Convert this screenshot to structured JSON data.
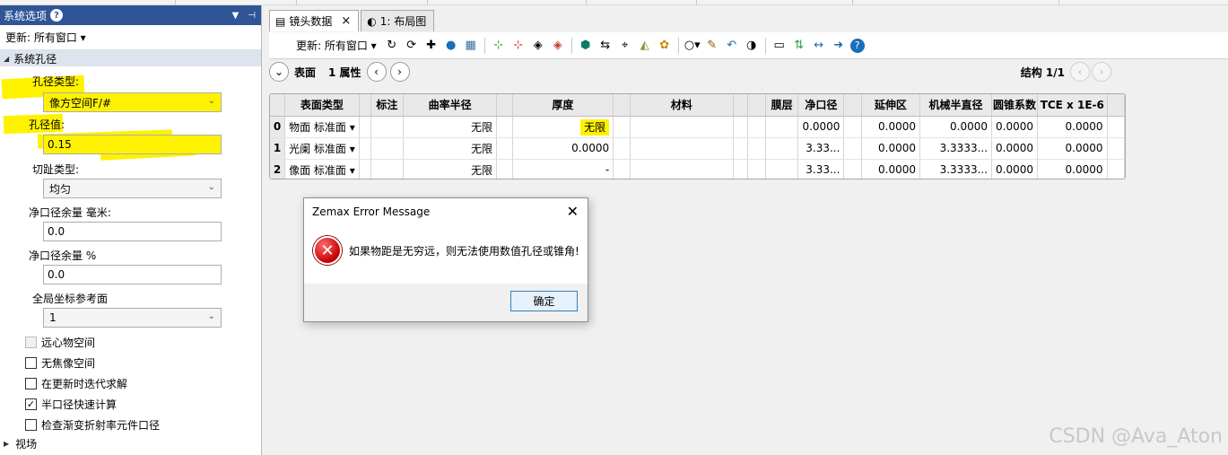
{
  "left_panel": {
    "title": "系统选项",
    "update_label": "更新: 所有窗口 ▾",
    "section": "系统孔径",
    "aperture_type_label": "孔径类型:",
    "aperture_type_value": "像方空间F/#",
    "aperture_value_label": "孔径值:",
    "aperture_value": "0.15",
    "apodization_label": "切趾类型:",
    "apodization_value": "均匀",
    "clear_margin_mm_label": "净口径余量 毫米:",
    "clear_margin_mm_value": "0.0",
    "clear_margin_pct_label": "净口径余量 %",
    "clear_margin_pct_value": "0.0",
    "global_ref_label": "全局坐标参考面",
    "global_ref_value": "1",
    "checkboxes": [
      {
        "label": "远心物空间",
        "checked": false,
        "disabled": true
      },
      {
        "label": "无焦像空间",
        "checked": false,
        "disabled": false
      },
      {
        "label": "在更新时迭代求解",
        "checked": false,
        "disabled": false
      },
      {
        "label": "半口径快速计算",
        "checked": true,
        "disabled": false
      },
      {
        "label": "检查渐变折射率元件口径",
        "checked": false,
        "disabled": false
      }
    ],
    "tree_field": "视场"
  },
  "tabs": [
    {
      "label": "镜头数据",
      "close": "×"
    },
    {
      "label": "1: 布局图"
    }
  ],
  "toolbar": {
    "update_label": "更新: 所有窗口 ▾"
  },
  "navbar": {
    "surface_label": "表面",
    "props_label": "1 属性",
    "config_label": "结构 1/1"
  },
  "table": {
    "headers": [
      "",
      "表面类型",
      "",
      "标注",
      "曲率半径",
      "",
      "厚度",
      "",
      "材料",
      "",
      "",
      "膜层",
      "净口径",
      "",
      "延伸区",
      "机械半直径",
      "圆锥系数",
      "TCE x 1E-6",
      ""
    ],
    "rows": [
      [
        "0",
        "物面",
        "标准面 ▾",
        "",
        "无限",
        "",
        "无限",
        "",
        "",
        "",
        "",
        "",
        "0.0000",
        "",
        "0.0000",
        "0.0000",
        "0.0000",
        "0.0000",
        ""
      ],
      [
        "1",
        "光阑",
        "标准面 ▾",
        "",
        "无限",
        "",
        "0.0000",
        "",
        "",
        "",
        "",
        "",
        "3.33...",
        "",
        "0.0000",
        "3.3333...",
        "0.0000",
        "0.0000",
        ""
      ],
      [
        "2",
        "像面",
        "标准面 ▾",
        "",
        "无限",
        "",
        "-",
        "",
        "",
        "",
        "",
        "",
        "3.33...",
        "",
        "0.0000",
        "3.3333...",
        "0.0000",
        "0.0000",
        ""
      ]
    ]
  },
  "dialog": {
    "title": "Zemax Error Message",
    "message": "如果物距是无穷远，则无法使用数值孔径或锥角!",
    "ok": "确定",
    "close": "✕"
  },
  "watermark": "CSDN @Ava_Aton",
  "colors": {
    "panel_title_bg": "#2f5597",
    "highlight": "#fff200",
    "error_red": "#c40000"
  }
}
